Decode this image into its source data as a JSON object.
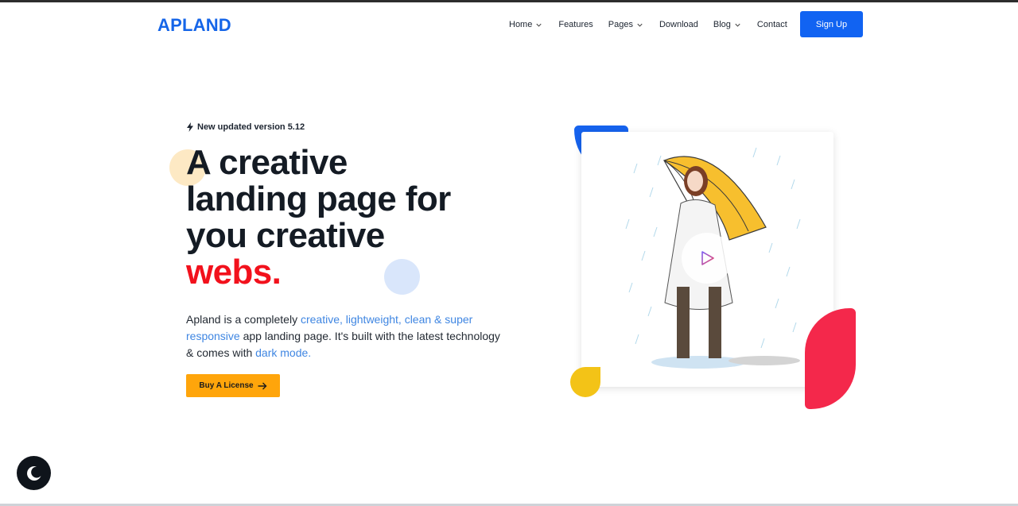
{
  "header": {
    "logo": "APLAND",
    "nav": [
      {
        "label": "Home",
        "dropdown": true
      },
      {
        "label": "Features",
        "dropdown": false
      },
      {
        "label": "Pages",
        "dropdown": true
      },
      {
        "label": "Download",
        "dropdown": false
      },
      {
        "label": "Blog",
        "dropdown": true
      },
      {
        "label": "Contact",
        "dropdown": false
      }
    ],
    "signup_label": "Sign Up"
  },
  "hero": {
    "version_icon": "lightning-bolt-icon",
    "version_text": "New updated version 5.12",
    "headline": {
      "line1": "A creative",
      "line2": "landing page for",
      "line3": "you creative",
      "accent": "webs."
    },
    "description": {
      "part1": "Apland is a completely ",
      "highlight1": "creative, lightweight, clean & super responsive",
      "part2": " app landing page. It's built with the latest technology & comes with ",
      "highlight2": "dark mode."
    },
    "cta_label": "Buy A License",
    "cta_icon": "arrow-right-icon",
    "video_icon": "play-icon"
  },
  "theme_toggle_icon": "moon-icon",
  "colors": {
    "brand_blue": "#1565e8",
    "accent_red": "#f2111c",
    "link_blue": "#3f86e2",
    "cta_orange": "#ffa50b",
    "shape_red": "#f4284b",
    "shape_yellow": "#f3c317"
  }
}
